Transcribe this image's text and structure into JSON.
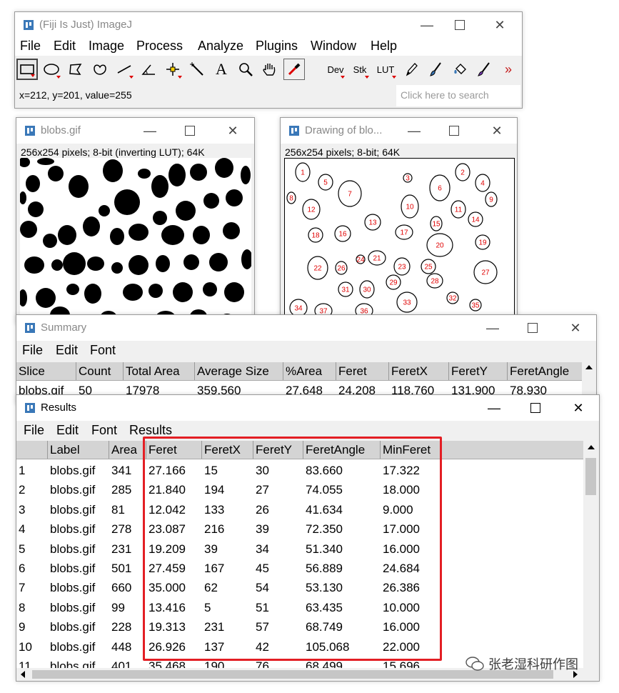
{
  "imagej": {
    "title": "(Fiji Is Just) ImageJ",
    "menu": [
      "File",
      "Edit",
      "Image",
      "Process",
      "Analyze",
      "Plugins",
      "Window",
      "Help"
    ],
    "tools": [
      "rectangle-tool",
      "oval-tool",
      "polygon-tool",
      "freehand-tool",
      "line-tool",
      "angle-tool",
      "point-tool",
      "wand-tool",
      "text-tool",
      "magnifier-tool",
      "scroll-tool",
      "color-picker-tool"
    ],
    "tool_text": {
      "dev": "Dev",
      "stk": "Stk",
      "lut": "LUT",
      "more": "»"
    },
    "status": "x=212, y=201, value=255",
    "search_placeholder": "Click here to search"
  },
  "blobs_window": {
    "title": "blobs.gif",
    "info": "256x254 pixels; 8-bit (inverting LUT); 64K"
  },
  "drawing_window": {
    "title": "Drawing of blo...",
    "info": "256x254 pixels; 8-bit; 64K",
    "labels": [
      "1",
      "2",
      "3",
      "4",
      "5",
      "6",
      "7",
      "8",
      "9",
      "10",
      "11",
      "12",
      "13",
      "14",
      "15",
      "16",
      "17",
      "18",
      "19",
      "20",
      "21",
      "22",
      "23",
      "24",
      "25",
      "26",
      "27",
      "28",
      "29",
      "30",
      "31",
      "32",
      "33",
      "34",
      "35",
      "36",
      "37"
    ]
  },
  "summary_window": {
    "title": "Summary",
    "menu": [
      "File",
      "Edit",
      "Font"
    ],
    "headers": [
      "Slice",
      "Count",
      "Total Area",
      "Average Size",
      "%Area",
      "Feret",
      "FeretX",
      "FeretY",
      "FeretAngle"
    ],
    "row": [
      "blobs.gif",
      "50",
      "17978",
      "359.560",
      "27.648",
      "24.208",
      "118.760",
      "131.900",
      "78.930"
    ]
  },
  "results_window": {
    "title": "Results",
    "menu": [
      "File",
      "Edit",
      "Font",
      "Results"
    ],
    "headers": [
      "",
      "Label",
      "Area",
      "Feret",
      "FeretX",
      "FeretY",
      "FeretAngle",
      "MinFeret"
    ],
    "rows": [
      [
        "1",
        "blobs.gif",
        "341",
        "27.166",
        "15",
        "30",
        "83.660",
        "17.322"
      ],
      [
        "2",
        "blobs.gif",
        "285",
        "21.840",
        "194",
        "27",
        "74.055",
        "18.000"
      ],
      [
        "3",
        "blobs.gif",
        "81",
        "12.042",
        "133",
        "26",
        "41.634",
        "9.000"
      ],
      [
        "4",
        "blobs.gif",
        "278",
        "23.087",
        "216",
        "39",
        "72.350",
        "17.000"
      ],
      [
        "5",
        "blobs.gif",
        "231",
        "19.209",
        "39",
        "34",
        "51.340",
        "16.000"
      ],
      [
        "6",
        "blobs.gif",
        "501",
        "27.459",
        "167",
        "45",
        "56.889",
        "24.684"
      ],
      [
        "7",
        "blobs.gif",
        "660",
        "35.000",
        "62",
        "54",
        "53.130",
        "26.386"
      ],
      [
        "8",
        "blobs.gif",
        "99",
        "13.416",
        "5",
        "51",
        "63.435",
        "10.000"
      ],
      [
        "9",
        "blobs.gif",
        "228",
        "19.313",
        "231",
        "57",
        "68.749",
        "16.000"
      ],
      [
        "10",
        "blobs.gif",
        "448",
        "26.926",
        "137",
        "42",
        "105.068",
        "22.000"
      ],
      [
        "11",
        "blobs.gif",
        "401",
        "35.468",
        "190",
        "76",
        "68.499",
        "15.696"
      ]
    ]
  },
  "watermark": "张老湿科研作图",
  "colors": {
    "highlight": "#e31e24",
    "label_red": "#e00000",
    "header_bg": "#d4d4d4"
  }
}
